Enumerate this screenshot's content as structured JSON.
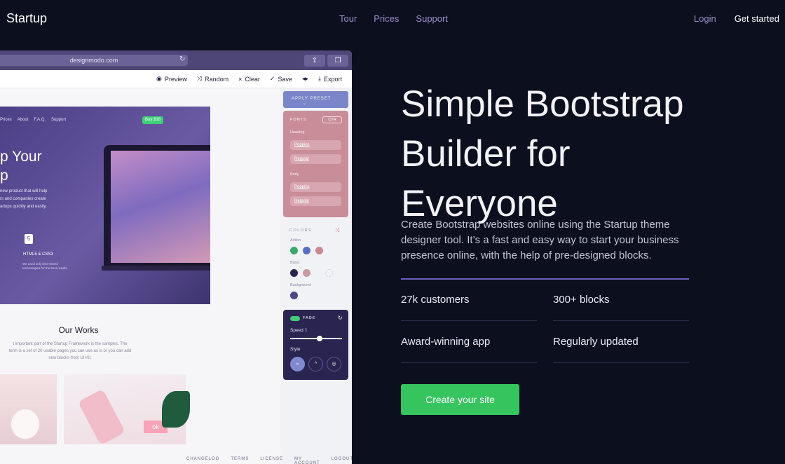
{
  "nav": {
    "logo": "Startup",
    "links": [
      "Tour",
      "Prices",
      "Support"
    ],
    "login": "Login",
    "get_started": "Get started"
  },
  "browser": {
    "url": "designmodo.com",
    "toolbar": {
      "preview": "Preview",
      "random": "Random",
      "clear": "Clear",
      "save": "Save",
      "export": "Export"
    },
    "hero": {
      "nav": [
        "Prices",
        "About",
        "F.A.Q.",
        "Support"
      ],
      "buy": "Buy $18",
      "title_line1": "p Your",
      "title_line2": "p",
      "paragraph": "new product that will help\nrs and companies create\nartups quickly and easily.",
      "tech_label": "HTML5 & CSS3",
      "tech_text": "We used only time-tested technologies for the best results."
    },
    "works": {
      "title": "Our Works",
      "text": "t important part of the Startup Framework is the samples. The\nterm is a set of 20 usable pages you can use as is or you can add\nnew blocks from UI Kit."
    },
    "footer": [
      "CHANGELOG",
      "TERMS",
      "LICENSE",
      "MY ACCOUNT",
      "LOGOUT"
    ],
    "sidebar": {
      "preset": "APPLY PRESET",
      "fonts_title": "FONTS",
      "cyr": "CYR",
      "heading_label": "Heading",
      "heading_font": "Poppins",
      "heading_weight": "Regular",
      "body_label": "Body",
      "body_font": "Poppins",
      "body_weight": "Regular",
      "colors_title": "COLORS",
      "action_label": "Action",
      "basic_label": "Basic",
      "background_label": "Background",
      "action_colors": [
        "#3aa96a",
        "#5b6fc2",
        "#c88892"
      ],
      "basic_colors": [
        "#2a2550",
        "#c79aa3",
        "#f1f2f6"
      ],
      "background_colors": [
        "#4b4685"
      ],
      "fade_label": "FADE",
      "speed_label": "Speed",
      "speed_value": "5",
      "style_label": "Style"
    }
  },
  "main": {
    "headline_line1": "Simple Bootstrap",
    "headline_line2": "Builder for",
    "headline_line3": "Everyone",
    "subtitle": "Create Bootstrap websites online using the Startup theme designer tool. It’s a fast and easy way to start your business presence online, with the help of pre-designed blocks.",
    "features": [
      "27k customers",
      "300+ blocks",
      "Award-winning app",
      "Regularly updated"
    ],
    "cta": "Create your site"
  },
  "colors": {
    "background": "#0b0f1e",
    "accent": "#6b5fb8",
    "cta": "#36c45f",
    "nav_link": "#9c8fcf"
  }
}
